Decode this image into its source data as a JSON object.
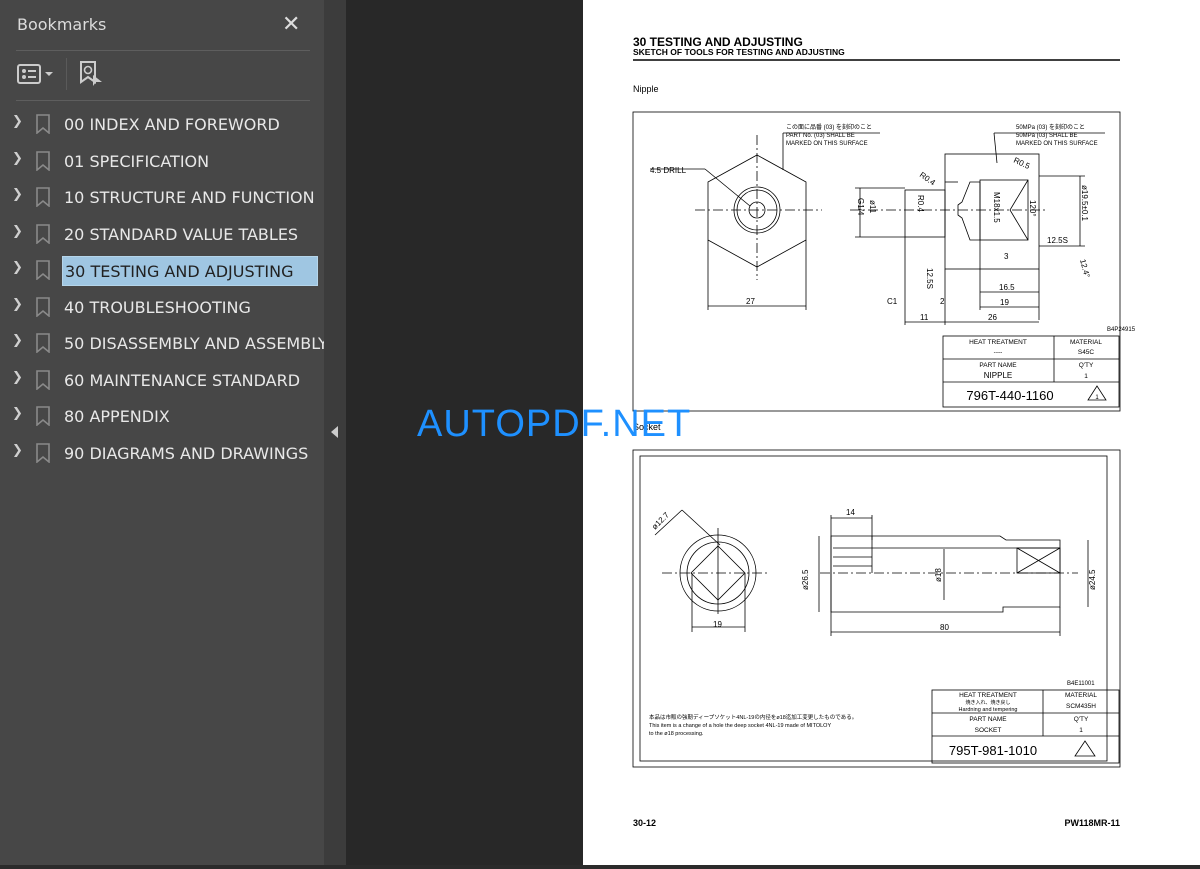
{
  "sidebar": {
    "title": "Bookmarks",
    "close_icon": "close-icon",
    "items": [
      {
        "label": "00 INDEX AND FOREWORD"
      },
      {
        "label": "01 SPECIFICATION"
      },
      {
        "label": "10 STRUCTURE AND FUNCTION"
      },
      {
        "label": "20 STANDARD VALUE TABLES"
      },
      {
        "label": "30 TESTING AND ADJUSTING",
        "selected": true
      },
      {
        "label": "40 TROUBLESHOOTING"
      },
      {
        "label": "50 DISASSEMBLY AND ASSEMBLY"
      },
      {
        "label": "60 MAINTENANCE STANDARD"
      },
      {
        "label": "80 APPENDIX"
      },
      {
        "label": "90 DIAGRAMS AND DRAWINGS"
      }
    ]
  },
  "page": {
    "title": "30 TESTING AND ADJUSTING",
    "subtitle": "SKETCH OF TOOLS FOR TESTING AND ADJUSTING",
    "page_number": "30-12",
    "model": "PW118MR-11",
    "nipple": {
      "label": "Nipple",
      "note_jp": "この面に品番 (03) を刻印のこと",
      "note_line1": "PART No. (03) SHALL BE",
      "note_line2": "MARKED ON THIS SURFACE",
      "note2_line0": "50MPa (03) を刻印のこと",
      "note2_line1": "50MPa (03) SHALL BE",
      "note2_line2": "MARKED ON THIS SURFACE",
      "dims": {
        "drill": "4.5 DRILL",
        "hex": "27",
        "r04a": "R0.4",
        "r04b": "R0.4",
        "r05": "R0.5",
        "g14": "G1/4",
        "d11": "ø11",
        "m18": "M18x1.5",
        "a120": "120°",
        "d195": "ø19.5±0.1",
        "s125a": "12.5S",
        "s125b": "12.5S",
        "d3": "3",
        "d165": "16.5",
        "d19": "19",
        "d26": "26",
        "d11b": "11",
        "c1": "C1",
        "d2": "2",
        "r124": "12.4°"
      },
      "drawing_no": "B4P24915",
      "heat_treatment_label": "HEAT TREATMENT",
      "heat_treatment": "----",
      "material_label": "MATERIAL",
      "material": "S45C",
      "part_name_label": "PART NAME",
      "part_name": "NIPPLE",
      "qty_label": "Q'TY",
      "qty": "1",
      "part_number": "796T-440-1160",
      "revision": "1"
    },
    "socket": {
      "label": "Socket",
      "dims": {
        "d127": "ø12.7",
        "d19": "19",
        "d14": "14",
        "d265": "ø26.5",
        "d18": "ø18",
        "d80": "80",
        "d245": "ø24.5"
      },
      "drawing_no": "B4E11001",
      "note_jp": "本品は市販の強靭ディープソケット4NL-19の内径をø18迄加工変更したものである。",
      "note_line1": "This item is a change of a hole the deep socket 4NL-19 made of MITOLOY",
      "note_line2": "to the ø18 processing.",
      "heat_treatment_label": "HEAT TREATMENT",
      "heat_treatment_jp": "焼き入れ、焼き戻し",
      "heat_treatment": "Hardning and tempering",
      "material_label": "MATERIAL",
      "material": "SCM435H",
      "part_name_label": "PART NAME",
      "part_name": "SOCKET",
      "qty_label": "Q'TY",
      "qty": "1",
      "part_number": "795T-981-1010"
    }
  },
  "watermark": "AUTOPDF.NET"
}
